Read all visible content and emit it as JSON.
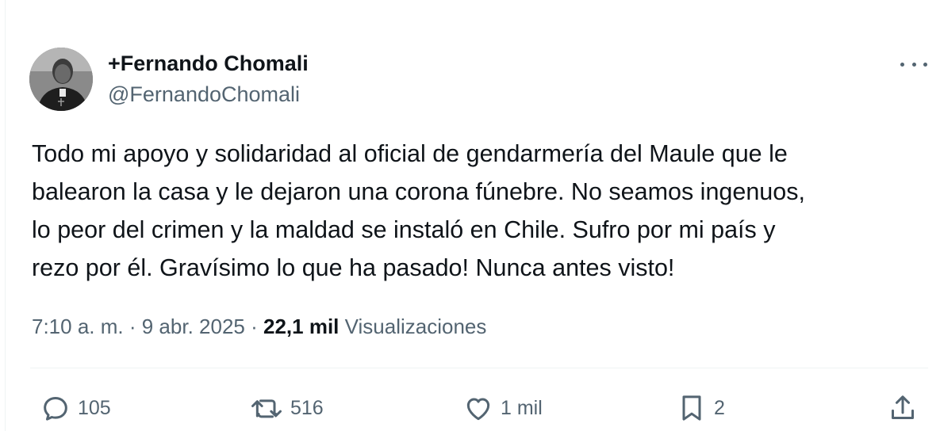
{
  "author": {
    "display_name": "+Fernando Chomali",
    "handle": "@FernandoChomali"
  },
  "tweet": {
    "lines": [
      "Todo mi apoyo y solidaridad al oficial de gendarmería del Maule que le",
      "balearon la casa y le dejaron una corona fúnebre. No seamos ingenuos,",
      "lo peor del crimen y la maldad se instaló en Chile. Sufro por mi país y",
      "rezo por él. Gravísimo lo que ha pasado! Nunca antes visto!"
    ]
  },
  "meta": {
    "time": "7:10 a. m.",
    "separator": "·",
    "date": "9 abr. 2025",
    "views_count": "22,1 mil",
    "views_label": "Visualizaciones"
  },
  "actions": {
    "replies": "105",
    "reposts": "516",
    "likes": "1 mil",
    "bookmarks": "2"
  },
  "icons": {
    "avatar": "profile-photo",
    "more": "more-options-icon",
    "reply": "reply-icon",
    "repost": "repost-icon",
    "like": "heart-icon",
    "bookmark": "bookmark-icon",
    "share": "share-icon"
  },
  "colors": {
    "text_primary": "#0f1419",
    "text_secondary": "#536471",
    "divider": "#eff3f4"
  }
}
